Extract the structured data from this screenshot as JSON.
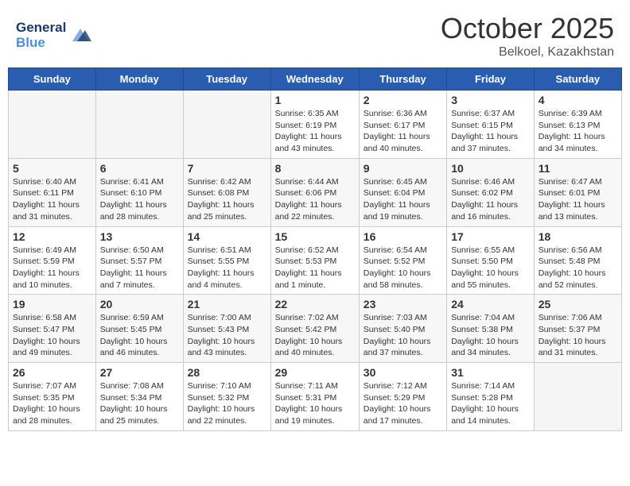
{
  "header": {
    "logo_line1": "General",
    "logo_line2": "Blue",
    "month_year": "October 2025",
    "location": "Belkoel, Kazakhstan"
  },
  "weekdays": [
    "Sunday",
    "Monday",
    "Tuesday",
    "Wednesday",
    "Thursday",
    "Friday",
    "Saturday"
  ],
  "weeks": [
    [
      {
        "day": "",
        "info": ""
      },
      {
        "day": "",
        "info": ""
      },
      {
        "day": "",
        "info": ""
      },
      {
        "day": "1",
        "info": "Sunrise: 6:35 AM\nSunset: 6:19 PM\nDaylight: 11 hours\nand 43 minutes."
      },
      {
        "day": "2",
        "info": "Sunrise: 6:36 AM\nSunset: 6:17 PM\nDaylight: 11 hours\nand 40 minutes."
      },
      {
        "day": "3",
        "info": "Sunrise: 6:37 AM\nSunset: 6:15 PM\nDaylight: 11 hours\nand 37 minutes."
      },
      {
        "day": "4",
        "info": "Sunrise: 6:39 AM\nSunset: 6:13 PM\nDaylight: 11 hours\nand 34 minutes."
      }
    ],
    [
      {
        "day": "5",
        "info": "Sunrise: 6:40 AM\nSunset: 6:11 PM\nDaylight: 11 hours\nand 31 minutes."
      },
      {
        "day": "6",
        "info": "Sunrise: 6:41 AM\nSunset: 6:10 PM\nDaylight: 11 hours\nand 28 minutes."
      },
      {
        "day": "7",
        "info": "Sunrise: 6:42 AM\nSunset: 6:08 PM\nDaylight: 11 hours\nand 25 minutes."
      },
      {
        "day": "8",
        "info": "Sunrise: 6:44 AM\nSunset: 6:06 PM\nDaylight: 11 hours\nand 22 minutes."
      },
      {
        "day": "9",
        "info": "Sunrise: 6:45 AM\nSunset: 6:04 PM\nDaylight: 11 hours\nand 19 minutes."
      },
      {
        "day": "10",
        "info": "Sunrise: 6:46 AM\nSunset: 6:02 PM\nDaylight: 11 hours\nand 16 minutes."
      },
      {
        "day": "11",
        "info": "Sunrise: 6:47 AM\nSunset: 6:01 PM\nDaylight: 11 hours\nand 13 minutes."
      }
    ],
    [
      {
        "day": "12",
        "info": "Sunrise: 6:49 AM\nSunset: 5:59 PM\nDaylight: 11 hours\nand 10 minutes."
      },
      {
        "day": "13",
        "info": "Sunrise: 6:50 AM\nSunset: 5:57 PM\nDaylight: 11 hours\nand 7 minutes."
      },
      {
        "day": "14",
        "info": "Sunrise: 6:51 AM\nSunset: 5:55 PM\nDaylight: 11 hours\nand 4 minutes."
      },
      {
        "day": "15",
        "info": "Sunrise: 6:52 AM\nSunset: 5:53 PM\nDaylight: 11 hours\nand 1 minute."
      },
      {
        "day": "16",
        "info": "Sunrise: 6:54 AM\nSunset: 5:52 PM\nDaylight: 10 hours\nand 58 minutes."
      },
      {
        "day": "17",
        "info": "Sunrise: 6:55 AM\nSunset: 5:50 PM\nDaylight: 10 hours\nand 55 minutes."
      },
      {
        "day": "18",
        "info": "Sunrise: 6:56 AM\nSunset: 5:48 PM\nDaylight: 10 hours\nand 52 minutes."
      }
    ],
    [
      {
        "day": "19",
        "info": "Sunrise: 6:58 AM\nSunset: 5:47 PM\nDaylight: 10 hours\nand 49 minutes."
      },
      {
        "day": "20",
        "info": "Sunrise: 6:59 AM\nSunset: 5:45 PM\nDaylight: 10 hours\nand 46 minutes."
      },
      {
        "day": "21",
        "info": "Sunrise: 7:00 AM\nSunset: 5:43 PM\nDaylight: 10 hours\nand 43 minutes."
      },
      {
        "day": "22",
        "info": "Sunrise: 7:02 AM\nSunset: 5:42 PM\nDaylight: 10 hours\nand 40 minutes."
      },
      {
        "day": "23",
        "info": "Sunrise: 7:03 AM\nSunset: 5:40 PM\nDaylight: 10 hours\nand 37 minutes."
      },
      {
        "day": "24",
        "info": "Sunrise: 7:04 AM\nSunset: 5:38 PM\nDaylight: 10 hours\nand 34 minutes."
      },
      {
        "day": "25",
        "info": "Sunrise: 7:06 AM\nSunset: 5:37 PM\nDaylight: 10 hours\nand 31 minutes."
      }
    ],
    [
      {
        "day": "26",
        "info": "Sunrise: 7:07 AM\nSunset: 5:35 PM\nDaylight: 10 hours\nand 28 minutes."
      },
      {
        "day": "27",
        "info": "Sunrise: 7:08 AM\nSunset: 5:34 PM\nDaylight: 10 hours\nand 25 minutes."
      },
      {
        "day": "28",
        "info": "Sunrise: 7:10 AM\nSunset: 5:32 PM\nDaylight: 10 hours\nand 22 minutes."
      },
      {
        "day": "29",
        "info": "Sunrise: 7:11 AM\nSunset: 5:31 PM\nDaylight: 10 hours\nand 19 minutes."
      },
      {
        "day": "30",
        "info": "Sunrise: 7:12 AM\nSunset: 5:29 PM\nDaylight: 10 hours\nand 17 minutes."
      },
      {
        "day": "31",
        "info": "Sunrise: 7:14 AM\nSunset: 5:28 PM\nDaylight: 10 hours\nand 14 minutes."
      },
      {
        "day": "",
        "info": ""
      }
    ]
  ]
}
